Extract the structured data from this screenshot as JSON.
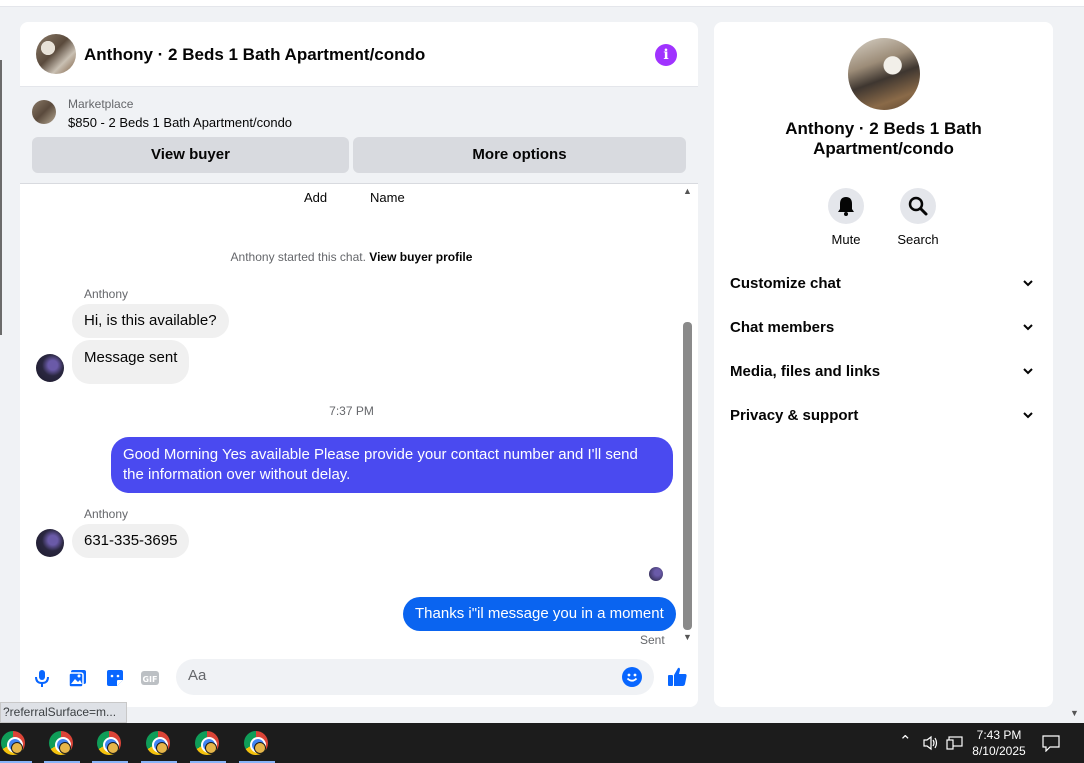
{
  "chat": {
    "header_title": "Anthony · 2 Beds 1 Bath Apartment/condo",
    "marketplace_label": "Marketplace",
    "listing": "$850 - 2 Beds 1 Bath Apartment/condo",
    "view_buyer": "View buyer",
    "more_options": "More options",
    "add_label": "Add",
    "name_label": "Name",
    "started_text": "Anthony started this chat.",
    "view_buyer_profile": "View buyer profile",
    "messages": [
      {
        "sender": "Anthony",
        "text": "Hi, is this available?"
      },
      {
        "text": "Message sent"
      },
      {
        "text": "Good Morning Yes available Please provide your contact number and I'll send the information over without delay."
      },
      {
        "sender": "Anthony",
        "text": "631-335-3695"
      },
      {
        "text": "Thanks i\"il message you in a moment"
      }
    ],
    "timestamp": "7:37 PM",
    "sent_status": "Sent",
    "input_placeholder": "Aa"
  },
  "info": {
    "title": "Anthony · 2 Beds 1 Bath Apartment/condo",
    "mute": "Mute",
    "search": "Search",
    "sections": [
      "Customize chat",
      "Chat members",
      "Media, files and links",
      "Privacy & support"
    ]
  },
  "status_url": "?referralSurface=m...",
  "taskbar": {
    "time": "7:43 PM",
    "date": "8/10/2025"
  },
  "colors": {
    "outgoing_bubble": "#4a4af0",
    "outgoing_bubble_2": "#0a64f0",
    "accent": "#0866ff",
    "info_icon": "#a033ff"
  }
}
